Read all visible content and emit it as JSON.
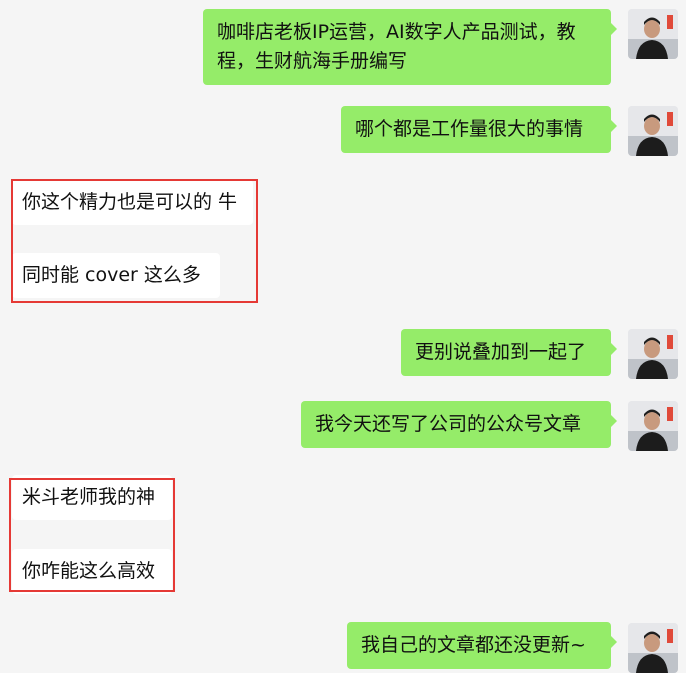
{
  "messages": {
    "m1": "咖啡店老板IP运营，AI数字人产品测试，教程，生财航海手册编写",
    "m2": "哪个都是工作量很大的事情",
    "m3": "你这个精力也是可以的 牛",
    "m4": "同时能 cover 这么多",
    "m5": "更别说叠加到一起了",
    "m6": "我今天还写了公司的公众号文章",
    "m7": "米斗老师我的神",
    "m8": "你咋能这么高效",
    "m9": "我自己的文章都还没更新~"
  },
  "colors": {
    "background": "#f5f5f5",
    "my_bubble": "#95ec69",
    "their_bubble": "#ffffff",
    "highlight_border": "#e53935"
  },
  "icons": {
    "avatar": "user-avatar-icon"
  }
}
